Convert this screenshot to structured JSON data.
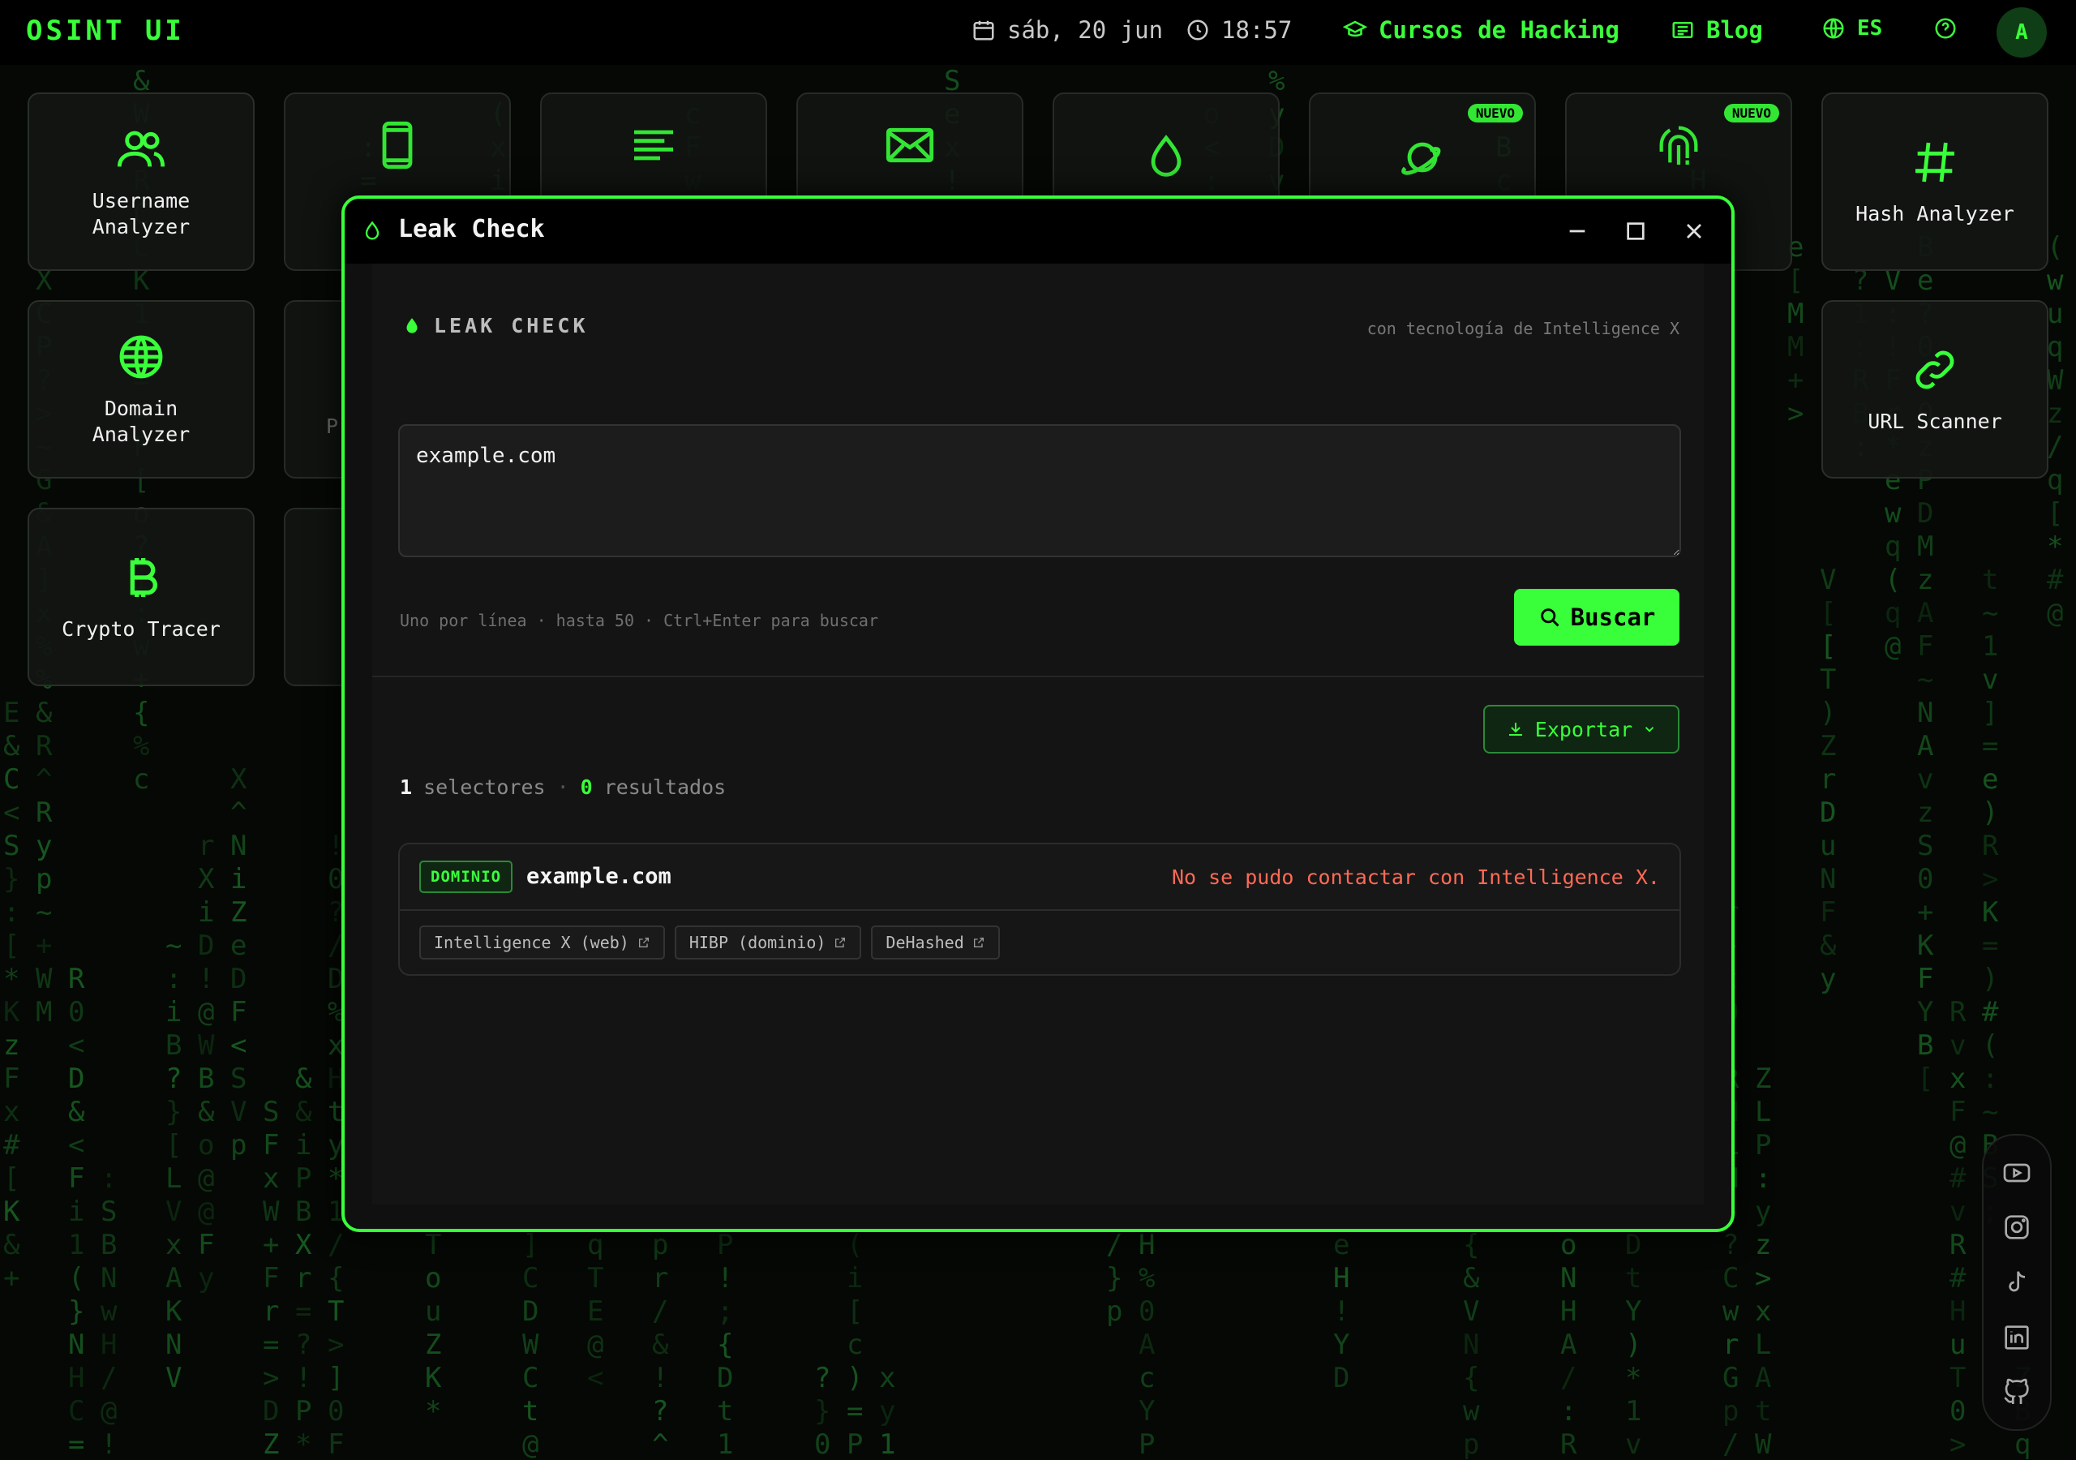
{
  "app": {
    "brand": "OSINT UI"
  },
  "topbar": {
    "date": "sáb, 20 jun",
    "time": "18:57",
    "courses": "Cursos de Hacking",
    "blog": "Blog",
    "lang": "ES",
    "avatar_initial": "A"
  },
  "tools": {
    "username": "Username\nAnalyzer",
    "domain": "Domain\nAnalyzer",
    "crypto": "Crypto Tracer",
    "hash": "Hash Analyzer",
    "url": "URL Scanner",
    "badge_new": "NUEVO",
    "partial_p": "P"
  },
  "modal": {
    "title": "Leak Check",
    "section_title": "LEAK CHECK",
    "powered_by": "con tecnología de Intelligence X",
    "input_value": "example.com",
    "hint": "Uno por línea · hasta 50 · Ctrl+Enter para buscar",
    "search_label": "Buscar",
    "export_label": "Exportar",
    "stats": {
      "selectors_count": "1",
      "selectors_label": "selectores",
      "separator": "·",
      "results_count": "0",
      "results_label": "resultados"
    },
    "result": {
      "tag": "DOMINIO",
      "domain": "example.com",
      "error": "No se pudo contactar con Intelligence X.",
      "links": [
        "Intelligence X (web)",
        "HIBP (dominio)",
        "DeHashed"
      ]
    }
  },
  "colors": {
    "accent": "#39ff3a",
    "error": "#ff6a55",
    "background": "#050805"
  },
  "icons": [
    "calendar-icon",
    "clock-icon",
    "graduation-cap-icon",
    "newspaper-icon",
    "globe-icon",
    "help-icon",
    "users-icon",
    "smartphone-icon",
    "text-lines-icon",
    "mail-icon",
    "drop-icon",
    "planet-icon",
    "fingerprint-icon",
    "hash-icon",
    "link-icon",
    "bitcoin-icon",
    "search-icon",
    "download-icon",
    "external-link-icon",
    "youtube-icon",
    "instagram-icon",
    "tiktok-icon",
    "linkedin-icon",
    "github-icon"
  ]
}
